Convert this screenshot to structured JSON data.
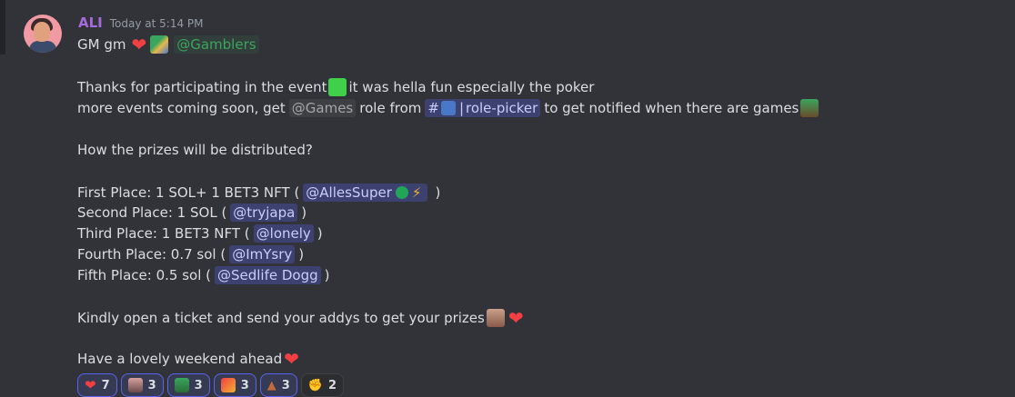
{
  "message": {
    "username": "ALI",
    "timestamp": "Today at 5:14 PM",
    "line1_text": "GM gm",
    "line1_role": "@Gamblers",
    "thanks_a": "Thanks for participating in the event",
    "thanks_b": "it was hella fun especially the poker",
    "events_a": "more events coming soon, get",
    "events_role": "@Games",
    "events_b": "role from",
    "channel_hash": "#",
    "channel_name": "role-picker",
    "events_c": "to get notified when there are games",
    "prize_question": "How the prizes will be distributed?",
    "prizes": [
      {
        "label": "First Place: 1 SOL+ 1 BET3 NFT (",
        "mention": "@AllesSuper",
        "close": ")"
      },
      {
        "label": "Second Place: 1 SOL (",
        "mention": "@tryjapa",
        "close": ")"
      },
      {
        "label": "Third Place: 1 BET3 NFT (",
        "mention": "@lonely",
        "close": ")"
      },
      {
        "label": "Fourth Place: 0.7 sol  (",
        "mention": "@ImYsry",
        "close": ")"
      },
      {
        "label": "Fifth Place: 0.5 sol (",
        "mention": "@Sedlife Dogg",
        "close": ")"
      }
    ],
    "ticket_text": "Kindly open a ticket and send your addys to get your prizes",
    "weekend_text": "Have a lovely weekend ahead"
  },
  "reactions": [
    {
      "emoji": "heart-emoji",
      "count": "7",
      "active": true
    },
    {
      "emoji": "pig-emoji",
      "count": "3",
      "active": true
    },
    {
      "emoji": "trophy-emoji",
      "count": "3",
      "active": true
    },
    {
      "emoji": "party-emoji",
      "count": "3",
      "active": true
    },
    {
      "emoji": "pile-emoji",
      "count": "3",
      "active": true
    },
    {
      "emoji": "handshake-emoji",
      "count": "2",
      "active": false
    }
  ],
  "colors": {
    "background": "#313338",
    "username": "#a66bdc",
    "mention_bg": "#3c4270",
    "role_green": "#3ba55d",
    "heart": "#f23f43"
  }
}
